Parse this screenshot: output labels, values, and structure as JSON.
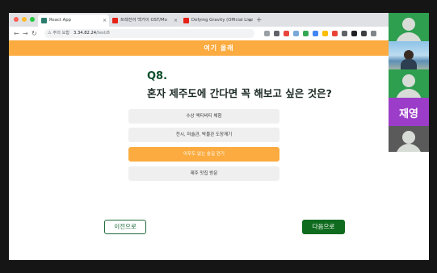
{
  "browser": {
    "tabs": [
      {
        "title": "React App",
        "favicon_color": "#2d7d6f"
      },
      {
        "title": "트레진어 백거이 OST/Mo",
        "favicon_color": "#e62117"
      },
      {
        "title": "Defying Gravity (Official Live",
        "favicon_color": "#e62117"
      }
    ],
    "security_label": "주의 요함",
    "url_host": "3.34.82.24",
    "url_path": "/test/8"
  },
  "page": {
    "header_title": "여기 올래",
    "question_number": "Q8.",
    "question_text": "혼자 제주도에 간다면 꼭 해보고 싶은 것은?",
    "options": [
      {
        "label": "수상 액티비티 체험",
        "selected": false
      },
      {
        "label": "전시, 미술관, 박물관 도장깨기",
        "selected": false
      },
      {
        "label": "아무도 없는 숲길 걷기",
        "selected": true
      },
      {
        "label": "제주 맛집 방문",
        "selected": false
      }
    ],
    "prev_label": "이전으로",
    "next_label": "다음으로"
  },
  "call_panel": {
    "participant_name": "재영"
  },
  "colors": {
    "accent": "#fbab3f",
    "primary_green": "#0f6b1e",
    "question_green": "#0d4d2a"
  }
}
